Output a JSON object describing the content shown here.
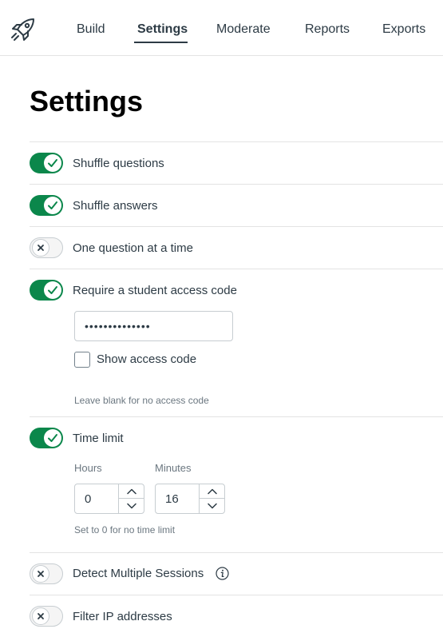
{
  "nav": {
    "tabs": [
      {
        "label": "Build"
      },
      {
        "label": "Settings"
      },
      {
        "label": "Moderate"
      },
      {
        "label": "Reports"
      },
      {
        "label": "Exports"
      }
    ],
    "active_tab": "Settings"
  },
  "page": {
    "title": "Settings"
  },
  "options": {
    "shuffle_questions": {
      "label": "Shuffle questions",
      "enabled": true
    },
    "shuffle_answers": {
      "label": "Shuffle answers",
      "enabled": true
    },
    "one_question": {
      "label": "One question at a time",
      "enabled": false
    },
    "access_code": {
      "label": "Require a student access code",
      "enabled": true,
      "masked_value": "••••••••••••••",
      "show_label": "Show access code",
      "show_checked": false,
      "hint": "Leave blank for no access code"
    },
    "time_limit": {
      "label": "Time limit",
      "enabled": true,
      "hours_label": "Hours",
      "hours_value": "0",
      "minutes_label": "Minutes",
      "minutes_value": "16",
      "hint": "Set to 0 for no time limit"
    },
    "detect_sessions": {
      "label": "Detect Multiple Sessions",
      "enabled": false
    },
    "filter_ip": {
      "label": "Filter IP addresses",
      "enabled": false
    }
  },
  "colors": {
    "toggle_on": "#0b874b",
    "text": "#2d3b45"
  },
  "icons": {
    "logo": "rocket-icon",
    "toggle_on": "check-icon",
    "toggle_off": "x-icon",
    "info": "info-icon",
    "stepper_up": "chevron-up-icon",
    "stepper_down": "chevron-down-icon"
  }
}
